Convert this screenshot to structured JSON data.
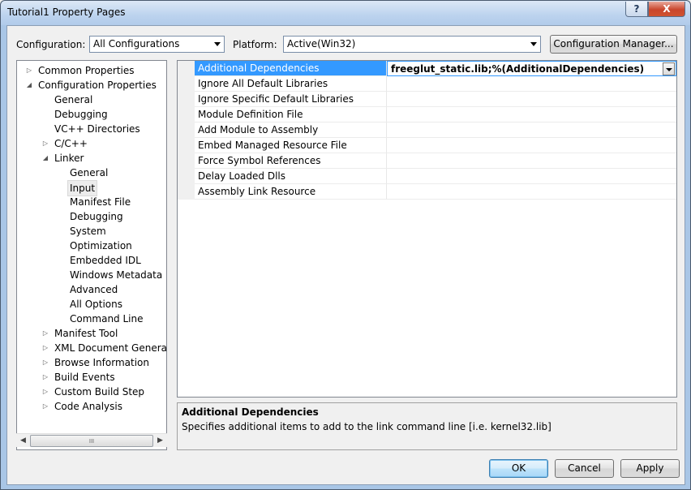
{
  "window": {
    "title": "Tutorial1 Property Pages",
    "help_label": "?",
    "close_label": "X"
  },
  "toolbar": {
    "configuration_label": "Configuration:",
    "configuration_value": "All Configurations",
    "platform_label": "Platform:",
    "platform_value": "Active(Win32)",
    "config_manager_label": "Configuration Manager..."
  },
  "tree": {
    "items": [
      {
        "label": "Common Properties",
        "level": 0,
        "expander": "▷"
      },
      {
        "label": "Configuration Properties",
        "level": 0,
        "expander": "◢"
      },
      {
        "label": "General",
        "level": 1,
        "expander": ""
      },
      {
        "label": "Debugging",
        "level": 1,
        "expander": ""
      },
      {
        "label": "VC++ Directories",
        "level": 1,
        "expander": ""
      },
      {
        "label": "C/C++",
        "level": 1,
        "expander": "▷"
      },
      {
        "label": "Linker",
        "level": 1,
        "expander": "◢"
      },
      {
        "label": "General",
        "level": 2,
        "expander": ""
      },
      {
        "label": "Input",
        "level": 2,
        "expander": "",
        "selected": true
      },
      {
        "label": "Manifest File",
        "level": 2,
        "expander": ""
      },
      {
        "label": "Debugging",
        "level": 2,
        "expander": ""
      },
      {
        "label": "System",
        "level": 2,
        "expander": ""
      },
      {
        "label": "Optimization",
        "level": 2,
        "expander": ""
      },
      {
        "label": "Embedded IDL",
        "level": 2,
        "expander": ""
      },
      {
        "label": "Windows Metadata",
        "level": 2,
        "expander": ""
      },
      {
        "label": "Advanced",
        "level": 2,
        "expander": ""
      },
      {
        "label": "All Options",
        "level": 2,
        "expander": ""
      },
      {
        "label": "Command Line",
        "level": 2,
        "expander": ""
      },
      {
        "label": "Manifest Tool",
        "level": 1,
        "expander": "▷"
      },
      {
        "label": "XML Document Generator",
        "level": 1,
        "expander": "▷"
      },
      {
        "label": "Browse Information",
        "level": 1,
        "expander": "▷"
      },
      {
        "label": "Build Events",
        "level": 1,
        "expander": "▷"
      },
      {
        "label": "Custom Build Step",
        "level": 1,
        "expander": "▷"
      },
      {
        "label": "Code Analysis",
        "level": 1,
        "expander": "▷"
      }
    ],
    "scroll_left": "◀",
    "scroll_right": "▶",
    "scroll_grip": "III"
  },
  "grid": {
    "rows": [
      {
        "name": "Additional Dependencies",
        "value": "freeglut_static.lib;%(AdditionalDependencies)",
        "selected": true
      },
      {
        "name": "Ignore All Default Libraries",
        "value": ""
      },
      {
        "name": "Ignore Specific Default Libraries",
        "value": ""
      },
      {
        "name": "Module Definition File",
        "value": ""
      },
      {
        "name": "Add Module to Assembly",
        "value": ""
      },
      {
        "name": "Embed Managed Resource File",
        "value": ""
      },
      {
        "name": "Force Symbol References",
        "value": ""
      },
      {
        "name": "Delay Loaded Dlls",
        "value": ""
      },
      {
        "name": "Assembly Link Resource",
        "value": ""
      }
    ]
  },
  "description": {
    "title": "Additional Dependencies",
    "text": "Specifies additional items to add to the link command line [i.e. kernel32.lib]"
  },
  "footer": {
    "ok_label": "OK",
    "cancel_label": "Cancel",
    "apply_label": "Apply"
  }
}
